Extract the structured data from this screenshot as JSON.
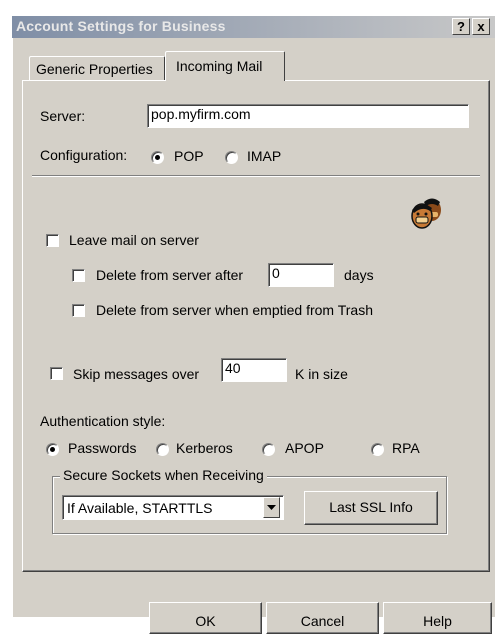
{
  "window": {
    "title": "Account Settings for Business",
    "help_label": "?",
    "close_label": "x"
  },
  "tabs": [
    {
      "label": "Generic Properties",
      "active": false
    },
    {
      "label": "Incoming Mail",
      "active": true
    }
  ],
  "server": {
    "label": "Server:",
    "value": "pop.myfirm.com"
  },
  "configuration": {
    "label": "Configuration:",
    "options": [
      "POP",
      "IMAP"
    ],
    "selected": "POP"
  },
  "icons": {
    "user": "users-icon"
  },
  "leave_mail": {
    "label": "Leave mail on server",
    "checked": false
  },
  "delete_after": {
    "label": "Delete from server after",
    "value": "0",
    "unit": "days",
    "checked": false
  },
  "delete_trash": {
    "label": "Delete from server when emptied from Trash",
    "checked": false
  },
  "skip_messages": {
    "label": "Skip messages over",
    "value": "40",
    "unit": "K in size",
    "checked": false
  },
  "auth": {
    "label": "Authentication style:",
    "options": [
      "Passwords",
      "Kerberos",
      "APOP",
      "RPA"
    ],
    "selected": "Passwords"
  },
  "ssl": {
    "group_label": "Secure Sockets when Receiving",
    "selected": "If Available, STARTTLS",
    "info_button": "Last SSL Info"
  },
  "buttons": {
    "ok": "OK",
    "cancel": "Cancel",
    "help": "Help"
  }
}
